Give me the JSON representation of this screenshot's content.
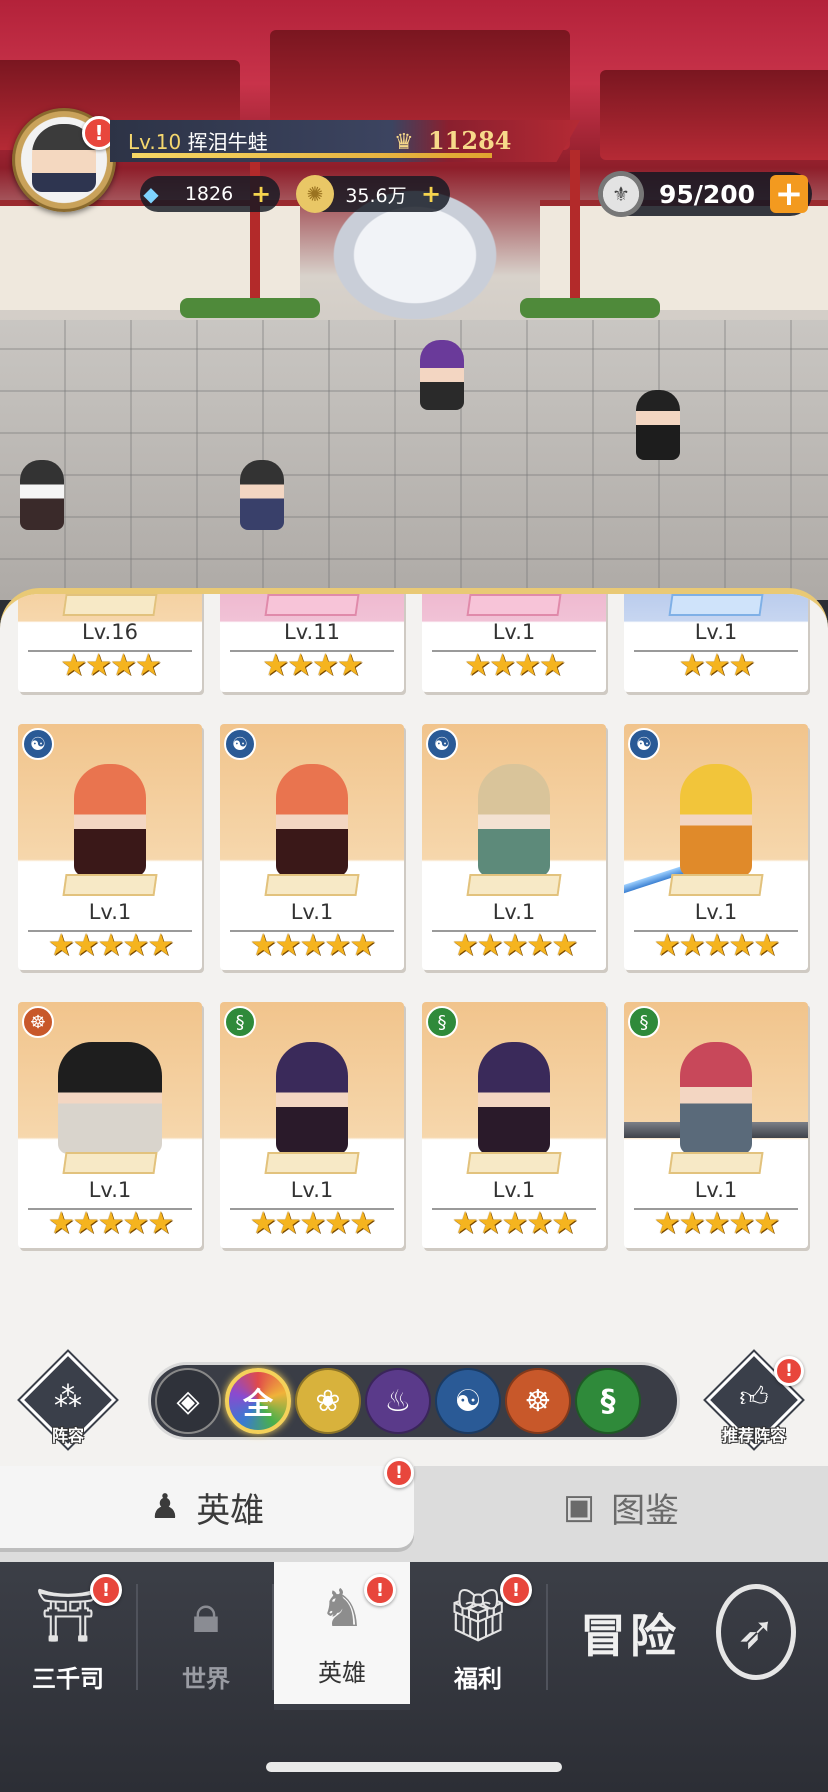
{
  "player": {
    "level": "Lv.10",
    "name": "挥泪牛蛙",
    "power": "11284"
  },
  "resources": {
    "diamonds": "1826",
    "gold": "35.6万",
    "stamina": "95/200"
  },
  "icons": {
    "diamond": "diamond-icon",
    "gold": "gold-coin-icon",
    "stamina": "stamina-icon",
    "power": "power-crest-icon",
    "alert": "alert-badge-icon"
  },
  "colors": {
    "alert": "#e8463c",
    "accent_gold": "#f4d15a",
    "card_bg": "#f1c48c",
    "panel_bg": "#f3f2f0"
  },
  "heroes": [
    {
      "level": "Lv.16",
      "stars": "★★★★",
      "bg": "orange",
      "element": ""
    },
    {
      "level": "Lv.11",
      "stars": "★★★★",
      "bg": "pink",
      "element": ""
    },
    {
      "level": "Lv.1",
      "stars": "★★★★",
      "bg": "pink",
      "element": ""
    },
    {
      "level": "Lv.1",
      "stars": "★★★",
      "bg": "blue",
      "element": ""
    },
    {
      "level": "Lv.1",
      "stars": "★★★★★",
      "bg": "orange",
      "element": "water"
    },
    {
      "level": "Lv.1",
      "stars": "★★★★★",
      "bg": "orange",
      "element": "water"
    },
    {
      "level": "Lv.1",
      "stars": "★★★★★",
      "bg": "orange",
      "element": "water"
    },
    {
      "level": "Lv.1",
      "stars": "★★★★★",
      "bg": "orange",
      "element": "water"
    },
    {
      "level": "Lv.1",
      "stars": "★★★★★",
      "bg": "orange",
      "element": "monk"
    },
    {
      "level": "Lv.1",
      "stars": "★★★★★",
      "bg": "orange",
      "element": "dna"
    },
    {
      "level": "Lv.1",
      "stars": "★★★★★",
      "bg": "orange",
      "element": "dna"
    },
    {
      "level": "Lv.1",
      "stars": "★★★★★",
      "bg": "orange",
      "element": "dna"
    }
  ],
  "lineup_button": {
    "label": "阵容"
  },
  "recommend_button": {
    "label": "推荐阵容"
  },
  "filters": [
    {
      "id": "formation",
      "label": "",
      "color": "#2f323a"
    },
    {
      "id": "all",
      "label": "全",
      "color": "#6a5a3a",
      "active": true
    },
    {
      "id": "lotus",
      "label": "",
      "color": "#d8b23c"
    },
    {
      "id": "fire",
      "label": "",
      "color": "#5a3a8a"
    },
    {
      "id": "water",
      "label": "",
      "color": "#2a5a96"
    },
    {
      "id": "monk",
      "label": "",
      "color": "#c8582a"
    },
    {
      "id": "dna",
      "label": "",
      "color": "#2f8a3a"
    }
  ],
  "tabs": {
    "heroes": "英雄",
    "codex": "图鉴"
  },
  "nav": {
    "items": [
      {
        "label": "三千司",
        "icon": "temple-icon"
      },
      {
        "label": "世界",
        "icon": "lock-icon"
      },
      {
        "label": "英雄",
        "icon": "hero-icon"
      },
      {
        "label": "福利",
        "icon": "gift-icon"
      }
    ],
    "adventure": "冒险"
  }
}
